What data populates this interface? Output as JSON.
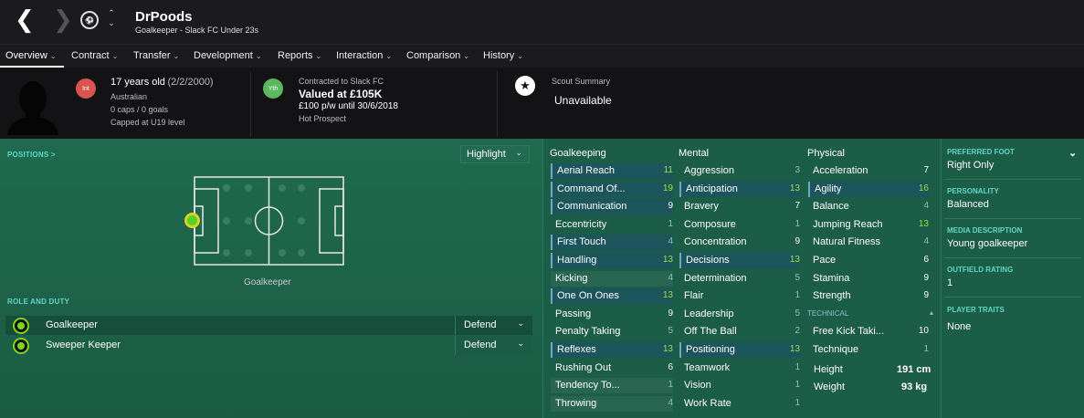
{
  "header": {
    "player_name": "DrPoods",
    "subtitle": "Goalkeeper - Slack FC Under 23s",
    "back_icon": "chevron-left-icon",
    "forward_icon": "chevron-right-icon",
    "club_badge_icon": "club-badge-icon",
    "updown_up": "⌃",
    "updown_down": "⌄"
  },
  "tabs": [
    {
      "label": "Overview",
      "active": true
    },
    {
      "label": "Contract"
    },
    {
      "label": "Transfer"
    },
    {
      "label": "Development"
    },
    {
      "label": "Reports"
    },
    {
      "label": "Interaction"
    },
    {
      "label": "Comparison"
    },
    {
      "label": "History"
    }
  ],
  "info": {
    "int_badge": "Int",
    "age": "17 years old",
    "dob": "(2/2/2000)",
    "nationality": "Australian",
    "caps": "0 caps / 0 goals",
    "capped": "Capped at U19 level",
    "yth_badge": "Yth",
    "contracted_to": "Contracted to Slack FC",
    "value": "Valued at £105K",
    "wage": "£100 p/w until 30/6/2018",
    "prospect": "Hot Prospect",
    "scout_title": "Scout Summary",
    "scout_value": "Unavailable"
  },
  "positions": {
    "label": "POSITIONS >",
    "highlight": "Highlight",
    "pitch_caption": "Goalkeeper"
  },
  "roles": {
    "label": "ROLE AND DUTY",
    "items": [
      {
        "name": "Goalkeeper",
        "duty": "Defend"
      },
      {
        "name": "Sweeper Keeper",
        "duty": "Defend"
      }
    ]
  },
  "attributes": {
    "goalkeeping_title": "Goalkeeping",
    "mental_title": "Mental",
    "physical_title": "Physical",
    "technical_title": "TECHNICAL",
    "goalkeeping": [
      {
        "name": "Aerial Reach",
        "value": "11",
        "style": "hl green"
      },
      {
        "name": "Command Of...",
        "value": "19",
        "style": "hl green"
      },
      {
        "name": "Communication",
        "value": "9",
        "style": "hl"
      },
      {
        "name": "Eccentricity",
        "value": "1",
        "style": "grey"
      },
      {
        "name": "First Touch",
        "value": "4",
        "style": "hl grey"
      },
      {
        "name": "Handling",
        "value": "13",
        "style": "hl green"
      },
      {
        "name": "Kicking",
        "value": "4",
        "style": "alt grey"
      },
      {
        "name": "One On Ones",
        "value": "13",
        "style": "hl green"
      },
      {
        "name": "Passing",
        "value": "9",
        "style": ""
      },
      {
        "name": "Penalty Taking",
        "value": "5",
        "style": "grey"
      },
      {
        "name": "Reflexes",
        "value": "13",
        "style": "hl green"
      },
      {
        "name": "Rushing Out",
        "value": "6",
        "style": ""
      },
      {
        "name": "Tendency To...",
        "value": "1",
        "style": "alt grey"
      },
      {
        "name": "Throwing",
        "value": "4",
        "style": "alt grey"
      }
    ],
    "mental": [
      {
        "name": "Aggression",
        "value": "3",
        "style": "grey"
      },
      {
        "name": "Anticipation",
        "value": "13",
        "style": "hl green"
      },
      {
        "name": "Bravery",
        "value": "7",
        "style": ""
      },
      {
        "name": "Composure",
        "value": "1",
        "style": "grey"
      },
      {
        "name": "Concentration",
        "value": "9",
        "style": ""
      },
      {
        "name": "Decisions",
        "value": "13",
        "style": "hl green"
      },
      {
        "name": "Determination",
        "value": "5",
        "style": "grey"
      },
      {
        "name": "Flair",
        "value": "1",
        "style": "grey"
      },
      {
        "name": "Leadership",
        "value": "5",
        "style": "grey"
      },
      {
        "name": "Off The Ball",
        "value": "2",
        "style": "grey"
      },
      {
        "name": "Positioning",
        "value": "13",
        "style": "hl green"
      },
      {
        "name": "Teamwork",
        "value": "1",
        "style": "grey"
      },
      {
        "name": "Vision",
        "value": "1",
        "style": "grey"
      },
      {
        "name": "Work Rate",
        "value": "1",
        "style": "grey"
      }
    ],
    "physical": [
      {
        "name": "Acceleration",
        "value": "7",
        "style": ""
      },
      {
        "name": "Agility",
        "value": "16",
        "style": "hl green"
      },
      {
        "name": "Balance",
        "value": "4",
        "style": "grey"
      },
      {
        "name": "Jumping Reach",
        "value": "13",
        "style": "green"
      },
      {
        "name": "Natural Fitness",
        "value": "4",
        "style": "grey"
      },
      {
        "name": "Pace",
        "value": "6",
        "style": ""
      },
      {
        "name": "Stamina",
        "value": "9",
        "style": ""
      },
      {
        "name": "Strength",
        "value": "9",
        "style": ""
      }
    ],
    "technical": [
      {
        "name": "Free Kick Taki...",
        "value": "10",
        "style": ""
      },
      {
        "name": "Technique",
        "value": "1",
        "style": "grey"
      }
    ],
    "height_label": "Height",
    "height_value": "191 cm",
    "weight_label": "Weight",
    "weight_value": "93 kg"
  },
  "profile": {
    "preferred_foot_label": "PREFERRED FOOT",
    "preferred_foot": "Right Only",
    "personality_label": "PERSONALITY",
    "personality": "Balanced",
    "media_label": "MEDIA DESCRIPTION",
    "media": "Young goalkeeper",
    "outfield_label": "OUTFIELD RATING",
    "outfield": "1",
    "traits_label": "PLAYER TRAITS",
    "traits": "None"
  },
  "colors": {
    "accent_green": "#9be23c",
    "label_teal": "#5fd6c8",
    "int_red": "#d9534f",
    "yth_green": "#5cb85c"
  }
}
